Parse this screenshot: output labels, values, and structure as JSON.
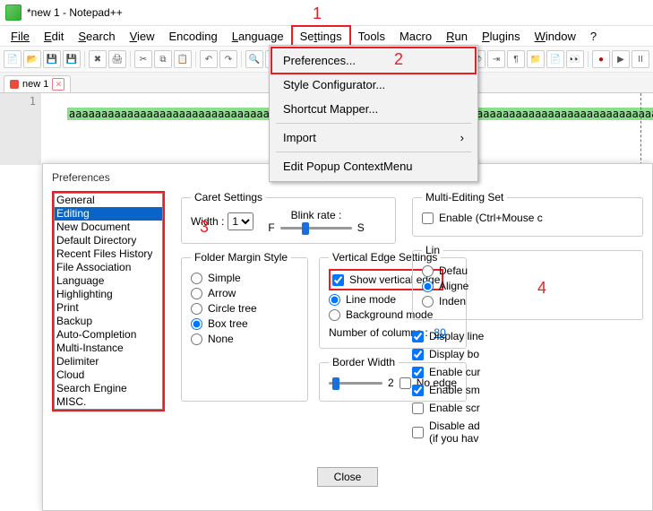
{
  "window": {
    "title": "*new 1 - Notepad++"
  },
  "menubar": [
    "File",
    "Edit",
    "Search",
    "View",
    "Encoding",
    "Language",
    "Settings",
    "Tools",
    "Macro",
    "Run",
    "Plugins",
    "Window",
    "?"
  ],
  "tab": {
    "name": "new 1"
  },
  "editor": {
    "line_no": "1",
    "text": "aaaaaaaaaaaaaaaaaaaaaaaaaaaaaaaaaaaaaaaaaaaaaaaaaaaaaaaaaaaaaaaaaaaaaaaaaaaaaaaaaaaaaaaaaaaaaaaa"
  },
  "dropdown": {
    "items": [
      "Preferences...",
      "Style Configurator...",
      "Shortcut Mapper...",
      "Import",
      "Edit Popup ContextMenu"
    ]
  },
  "annotations": {
    "a1": "1",
    "a2": "2",
    "a3": "3",
    "a4": "4"
  },
  "prefs": {
    "title": "Preferences",
    "categories": [
      "General",
      "Editing",
      "New Document",
      "Default Directory",
      "Recent Files History",
      "File Association",
      "Language",
      "Highlighting",
      "Print",
      "Backup",
      "Auto-Completion",
      "Multi-Instance",
      "Delimiter",
      "Cloud",
      "Search Engine",
      "MISC."
    ],
    "selected": "Editing",
    "caret": {
      "legend": "Caret Settings",
      "width_label": "Width :",
      "width_value": "1",
      "blink_label": "Blink rate :",
      "f": "F",
      "s": "S"
    },
    "folder": {
      "legend": "Folder Margin Style",
      "opts": [
        "Simple",
        "Arrow",
        "Circle tree",
        "Box tree",
        "None"
      ],
      "checked": "Box tree"
    },
    "vedge": {
      "legend": "Vertical Edge Settings",
      "show": "Show vertical edge",
      "line": "Line mode",
      "bg": "Background mode",
      "ncol_label": "Number of columns :",
      "ncol": "80"
    },
    "border": {
      "legend": "Border Width",
      "value": "2",
      "noedge": "No edge"
    },
    "multi": {
      "legend": "Multi-Editing Set",
      "enable": "Enable (Ctrl+Mouse c"
    },
    "linewrap": {
      "legend": "Lin",
      "opts": [
        "Defau",
        "Aligne",
        "Inden"
      ],
      "checked": "Aligne"
    },
    "checks": [
      "Display line",
      "Display bo",
      "Enable cur",
      "Enable sm",
      "Enable scr",
      "Disable ad\n(if you hav"
    ],
    "checks_state": [
      true,
      true,
      true,
      true,
      false,
      false
    ],
    "close": "Close"
  }
}
